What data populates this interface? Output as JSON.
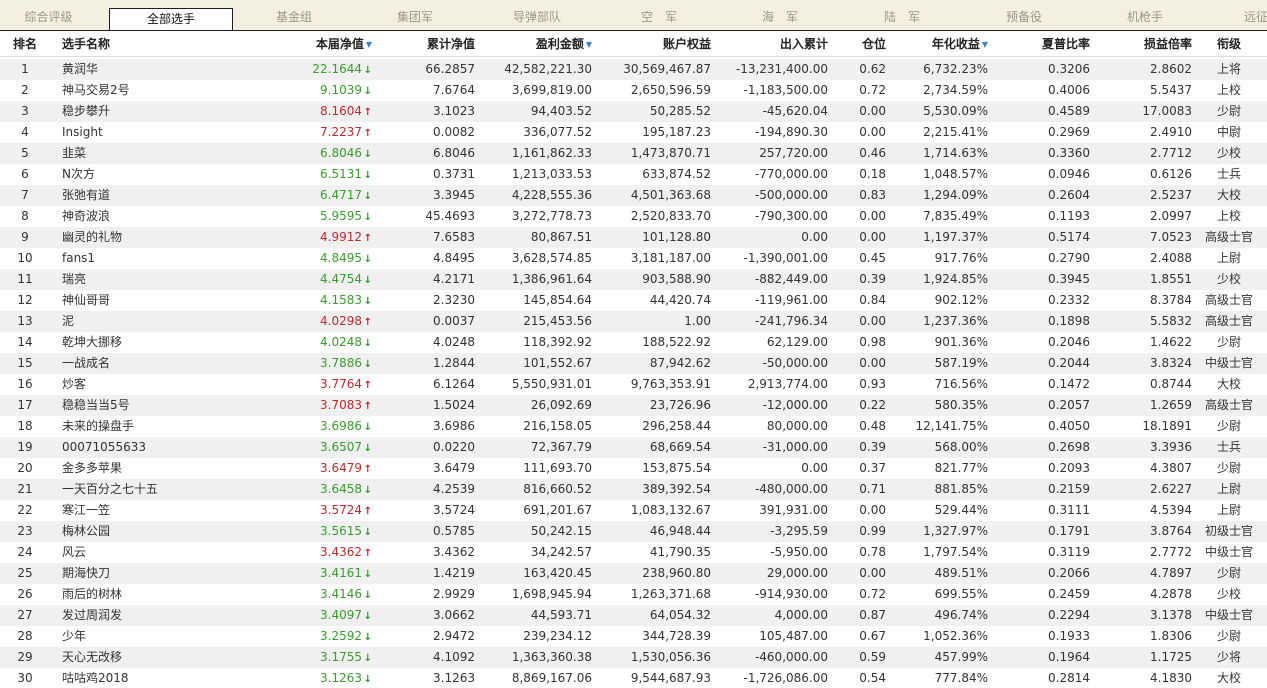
{
  "tabs": [
    {
      "label": "综合评级",
      "active": false
    },
    {
      "label": "全部选手",
      "active": true
    },
    {
      "label": "基金组",
      "active": false
    },
    {
      "label": "集团军",
      "active": false
    },
    {
      "label": "导弹部队",
      "active": false
    },
    {
      "label": "空　军",
      "active": false
    },
    {
      "label": "海　军",
      "active": false
    },
    {
      "label": "陆　军",
      "active": false
    },
    {
      "label": "预备役",
      "active": false
    },
    {
      "label": "机枪手",
      "active": false
    },
    {
      "label": "远征",
      "active": false
    }
  ],
  "columns": {
    "rank": "排名",
    "name": "选手名称",
    "nav": "本届净值",
    "cum_nav": "累计净值",
    "profit": "盈利金额",
    "equity": "账户权益",
    "inout": "出入累计",
    "position": "仓位",
    "annual": "年化收益",
    "sharpe": "夏普比率",
    "pl_ratio": "损益倍率",
    "rank_title": "衔级"
  },
  "sort_indicator": "▼",
  "colors": {
    "down": "#3a9c2f",
    "up": "#c0282e",
    "sort": "#3d86c6",
    "tab_bg": "#f4f0e1",
    "row_alt": "#f0f0f0"
  },
  "rows": [
    {
      "rank": "1",
      "name": "黄润华",
      "nav": "22.1644",
      "trend": "down",
      "cum": "66.2857",
      "profit": "42,582,221.30",
      "equity": "30,569,467.87",
      "inout": "-13,231,400.00",
      "pos": "0.62",
      "annual": "6,732.23%",
      "sharpe": "0.3206",
      "plr": "2.8602",
      "title": "上将"
    },
    {
      "rank": "2",
      "name": "神马交易2号",
      "nav": "9.1039",
      "trend": "down",
      "cum": "7.6764",
      "profit": "3,699,819.00",
      "equity": "2,650,596.59",
      "inout": "-1,183,500.00",
      "pos": "0.72",
      "annual": "2,734.59%",
      "sharpe": "0.4006",
      "plr": "5.5437",
      "title": "上校"
    },
    {
      "rank": "3",
      "name": "稳步攀升",
      "nav": "8.1604",
      "trend": "up",
      "cum": "3.1023",
      "profit": "94,403.52",
      "equity": "50,285.52",
      "inout": "-45,620.04",
      "pos": "0.00",
      "annual": "5,530.09%",
      "sharpe": "0.4589",
      "plr": "17.0083",
      "title": "少尉"
    },
    {
      "rank": "4",
      "name": "Insight",
      "nav": "7.2237",
      "trend": "up",
      "cum": "0.0082",
      "profit": "336,077.52",
      "equity": "195,187.23",
      "inout": "-194,890.30",
      "pos": "0.00",
      "annual": "2,215.41%",
      "sharpe": "0.2969",
      "plr": "2.4910",
      "title": "中尉"
    },
    {
      "rank": "5",
      "name": "韭菜",
      "nav": "6.8046",
      "trend": "down",
      "cum": "6.8046",
      "profit": "1,161,862.33",
      "equity": "1,473,870.71",
      "inout": "257,720.00",
      "pos": "0.46",
      "annual": "1,714.63%",
      "sharpe": "0.3360",
      "plr": "2.7712",
      "title": "少校"
    },
    {
      "rank": "6",
      "name": "N次方",
      "nav": "6.5131",
      "trend": "down",
      "cum": "0.3731",
      "profit": "1,213,033.53",
      "equity": "633,874.52",
      "inout": "-770,000.00",
      "pos": "0.18",
      "annual": "1,048.57%",
      "sharpe": "0.0946",
      "plr": "0.6126",
      "title": "士兵"
    },
    {
      "rank": "7",
      "name": "张弛有道",
      "nav": "6.4717",
      "trend": "down",
      "cum": "3.3945",
      "profit": "4,228,555.36",
      "equity": "4,501,363.68",
      "inout": "-500,000.00",
      "pos": "0.83",
      "annual": "1,294.09%",
      "sharpe": "0.2604",
      "plr": "2.5237",
      "title": "大校"
    },
    {
      "rank": "8",
      "name": "神奇波浪",
      "nav": "5.9595",
      "trend": "down",
      "cum": "45.4693",
      "profit": "3,272,778.73",
      "equity": "2,520,833.70",
      "inout": "-790,300.00",
      "pos": "0.00",
      "annual": "7,835.49%",
      "sharpe": "0.1193",
      "plr": "2.0997",
      "title": "上校"
    },
    {
      "rank": "9",
      "name": "幽灵的礼物",
      "nav": "4.9912",
      "trend": "up",
      "cum": "7.6583",
      "profit": "80,867.51",
      "equity": "101,128.80",
      "inout": "0.00",
      "pos": "0.00",
      "annual": "1,197.37%",
      "sharpe": "0.5174",
      "plr": "7.0523",
      "title": "高级士官"
    },
    {
      "rank": "10",
      "name": "fans1",
      "nav": "4.8495",
      "trend": "down",
      "cum": "4.8495",
      "profit": "3,628,574.85",
      "equity": "3,181,187.00",
      "inout": "-1,390,001.00",
      "pos": "0.45",
      "annual": "917.76%",
      "sharpe": "0.2790",
      "plr": "2.4088",
      "title": "上尉"
    },
    {
      "rank": "11",
      "name": "瑞亮",
      "nav": "4.4754",
      "trend": "down",
      "cum": "4.2171",
      "profit": "1,386,961.64",
      "equity": "903,588.90",
      "inout": "-882,449.00",
      "pos": "0.39",
      "annual": "1,924.85%",
      "sharpe": "0.3945",
      "plr": "1.8551",
      "title": "少校"
    },
    {
      "rank": "12",
      "name": "神仙哥哥",
      "nav": "4.1583",
      "trend": "down",
      "cum": "2.3230",
      "profit": "145,854.64",
      "equity": "44,420.74",
      "inout": "-119,961.00",
      "pos": "0.84",
      "annual": "902.12%",
      "sharpe": "0.2332",
      "plr": "8.3784",
      "title": "高级士官"
    },
    {
      "rank": "13",
      "name": "泥",
      "nav": "4.0298",
      "trend": "up",
      "cum": "0.0037",
      "profit": "215,453.56",
      "equity": "1.00",
      "inout": "-241,796.34",
      "pos": "0.00",
      "annual": "1,237.36%",
      "sharpe": "0.1898",
      "plr": "5.5832",
      "title": "高级士官"
    },
    {
      "rank": "14",
      "name": "乾坤大挪移",
      "nav": "4.0248",
      "trend": "down",
      "cum": "4.0248",
      "profit": "118,392.92",
      "equity": "188,522.92",
      "inout": "62,129.00",
      "pos": "0.98",
      "annual": "901.36%",
      "sharpe": "0.2046",
      "plr": "1.4622",
      "title": "少尉"
    },
    {
      "rank": "15",
      "name": "一战成名",
      "nav": "3.7886",
      "trend": "down",
      "cum": "1.2844",
      "profit": "101,552.67",
      "equity": "87,942.62",
      "inout": "-50,000.00",
      "pos": "0.00",
      "annual": "587.19%",
      "sharpe": "0.2044",
      "plr": "3.8324",
      "title": "中级士官"
    },
    {
      "rank": "16",
      "name": "炒客",
      "nav": "3.7764",
      "trend": "up",
      "cum": "6.1264",
      "profit": "5,550,931.01",
      "equity": "9,763,353.91",
      "inout": "2,913,774.00",
      "pos": "0.93",
      "annual": "716.56%",
      "sharpe": "0.1472",
      "plr": "0.8744",
      "title": "大校"
    },
    {
      "rank": "17",
      "name": "稳稳当当5号",
      "nav": "3.7083",
      "trend": "up",
      "cum": "1.5024",
      "profit": "26,092.69",
      "equity": "23,726.96",
      "inout": "-12,000.00",
      "pos": "0.22",
      "annual": "580.35%",
      "sharpe": "0.2057",
      "plr": "1.2659",
      "title": "高级士官"
    },
    {
      "rank": "18",
      "name": "未来的操盘手",
      "nav": "3.6986",
      "trend": "down",
      "cum": "3.6986",
      "profit": "216,158.05",
      "equity": "296,258.44",
      "inout": "80,000.00",
      "pos": "0.48",
      "annual": "12,141.75%",
      "sharpe": "0.4050",
      "plr": "18.1891",
      "title": "少尉"
    },
    {
      "rank": "19",
      "name": "00071055633",
      "nav": "3.6507",
      "trend": "down",
      "cum": "0.0220",
      "profit": "72,367.79",
      "equity": "68,669.54",
      "inout": "-31,000.00",
      "pos": "0.39",
      "annual": "568.00%",
      "sharpe": "0.2698",
      "plr": "3.3936",
      "title": "士兵"
    },
    {
      "rank": "20",
      "name": "金多多苹果",
      "nav": "3.6479",
      "trend": "up",
      "cum": "3.6479",
      "profit": "111,693.70",
      "equity": "153,875.54",
      "inout": "0.00",
      "pos": "0.37",
      "annual": "821.77%",
      "sharpe": "0.2093",
      "plr": "4.3807",
      "title": "少尉"
    },
    {
      "rank": "21",
      "name": "一天百分之七十五",
      "nav": "3.6458",
      "trend": "down",
      "cum": "4.2539",
      "profit": "816,660.52",
      "equity": "389,392.54",
      "inout": "-480,000.00",
      "pos": "0.71",
      "annual": "881.85%",
      "sharpe": "0.2159",
      "plr": "2.6227",
      "title": "上尉"
    },
    {
      "rank": "22",
      "name": "寒江一笠",
      "nav": "3.5724",
      "trend": "up",
      "cum": "3.5724",
      "profit": "691,201.67",
      "equity": "1,083,132.67",
      "inout": "391,931.00",
      "pos": "0.00",
      "annual": "529.44%",
      "sharpe": "0.3111",
      "plr": "4.5394",
      "title": "上尉"
    },
    {
      "rank": "23",
      "name": "梅林公园",
      "nav": "3.5615",
      "trend": "down",
      "cum": "0.5785",
      "profit": "50,242.15",
      "equity": "46,948.44",
      "inout": "-3,295.59",
      "pos": "0.99",
      "annual": "1,327.97%",
      "sharpe": "0.1791",
      "plr": "3.8764",
      "title": "初级士官"
    },
    {
      "rank": "24",
      "name": "风云",
      "nav": "3.4362",
      "trend": "up",
      "cum": "3.4362",
      "profit": "34,242.57",
      "equity": "41,790.35",
      "inout": "-5,950.00",
      "pos": "0.78",
      "annual": "1,797.54%",
      "sharpe": "0.3119",
      "plr": "2.7772",
      "title": "中级士官"
    },
    {
      "rank": "25",
      "name": "期海快刀",
      "nav": "3.4161",
      "trend": "down",
      "cum": "1.4219",
      "profit": "163,420.45",
      "equity": "238,960.80",
      "inout": "29,000.00",
      "pos": "0.00",
      "annual": "489.51%",
      "sharpe": "0.2066",
      "plr": "4.7897",
      "title": "少尉"
    },
    {
      "rank": "26",
      "name": "雨后的树林",
      "nav": "3.4146",
      "trend": "down",
      "cum": "2.9929",
      "profit": "1,698,945.94",
      "equity": "1,263,371.68",
      "inout": "-914,930.00",
      "pos": "0.72",
      "annual": "699.55%",
      "sharpe": "0.2459",
      "plr": "4.2878",
      "title": "少校"
    },
    {
      "rank": "27",
      "name": "发过周润发",
      "nav": "3.4097",
      "trend": "down",
      "cum": "3.0662",
      "profit": "44,593.71",
      "equity": "64,054.32",
      "inout": "4,000.00",
      "pos": "0.87",
      "annual": "496.74%",
      "sharpe": "0.2294",
      "plr": "3.1378",
      "title": "中级士官"
    },
    {
      "rank": "28",
      "name": "少年",
      "nav": "3.2592",
      "trend": "down",
      "cum": "2.9472",
      "profit": "239,234.12",
      "equity": "344,728.39",
      "inout": "105,487.00",
      "pos": "0.67",
      "annual": "1,052.36%",
      "sharpe": "0.1933",
      "plr": "1.8306",
      "title": "少尉"
    },
    {
      "rank": "29",
      "name": "天心无改移",
      "nav": "3.1755",
      "trend": "down",
      "cum": "4.1092",
      "profit": "1,363,360.38",
      "equity": "1,530,056.36",
      "inout": "-460,000.00",
      "pos": "0.59",
      "annual": "457.99%",
      "sharpe": "0.1964",
      "plr": "1.1725",
      "title": "少将"
    },
    {
      "rank": "30",
      "name": "咕咕鸡2018",
      "nav": "3.1263",
      "trend": "down",
      "cum": "3.1263",
      "profit": "8,869,167.06",
      "equity": "9,544,687.93",
      "inout": "-1,726,086.00",
      "pos": "0.54",
      "annual": "777.84%",
      "sharpe": "0.2814",
      "plr": "4.1830",
      "title": "大校"
    }
  ]
}
